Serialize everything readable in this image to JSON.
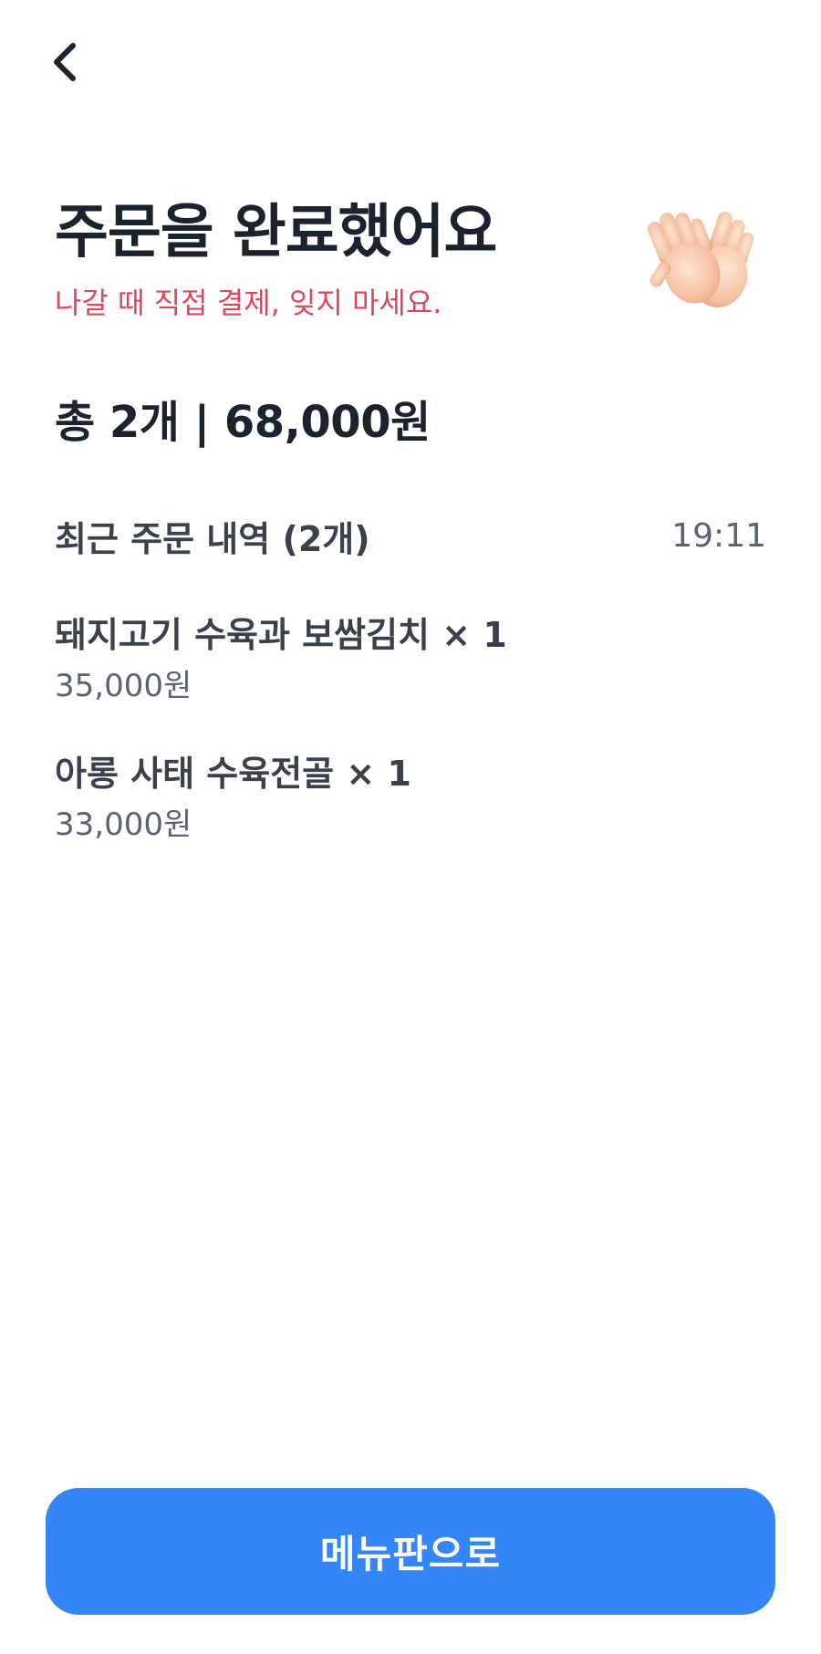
{
  "header": {
    "back_icon": "chevron-left-icon"
  },
  "confirmation": {
    "title": "주문을 완료했어요",
    "subtitle": "나갈 때 직접 결제, 잊지 마세요.",
    "icon": "clapping-hands-icon"
  },
  "summary": {
    "text": "총 2개 | 68,000원"
  },
  "history": {
    "title": "최근 주문 내역 (2개)",
    "time": "19:11",
    "items": [
      {
        "name": "돼지고기 수육과 보쌈김치 × 1",
        "price": "35,000원"
      },
      {
        "name": "아롱 사태 수육전골 × 1",
        "price": "33,000원"
      }
    ]
  },
  "footer": {
    "button_label": "메뉴판으로"
  },
  "colors": {
    "accent": "#3485f8",
    "warning_text": "#e0465a",
    "title_text": "#1b2230",
    "secondary_text": "#5c6370"
  }
}
